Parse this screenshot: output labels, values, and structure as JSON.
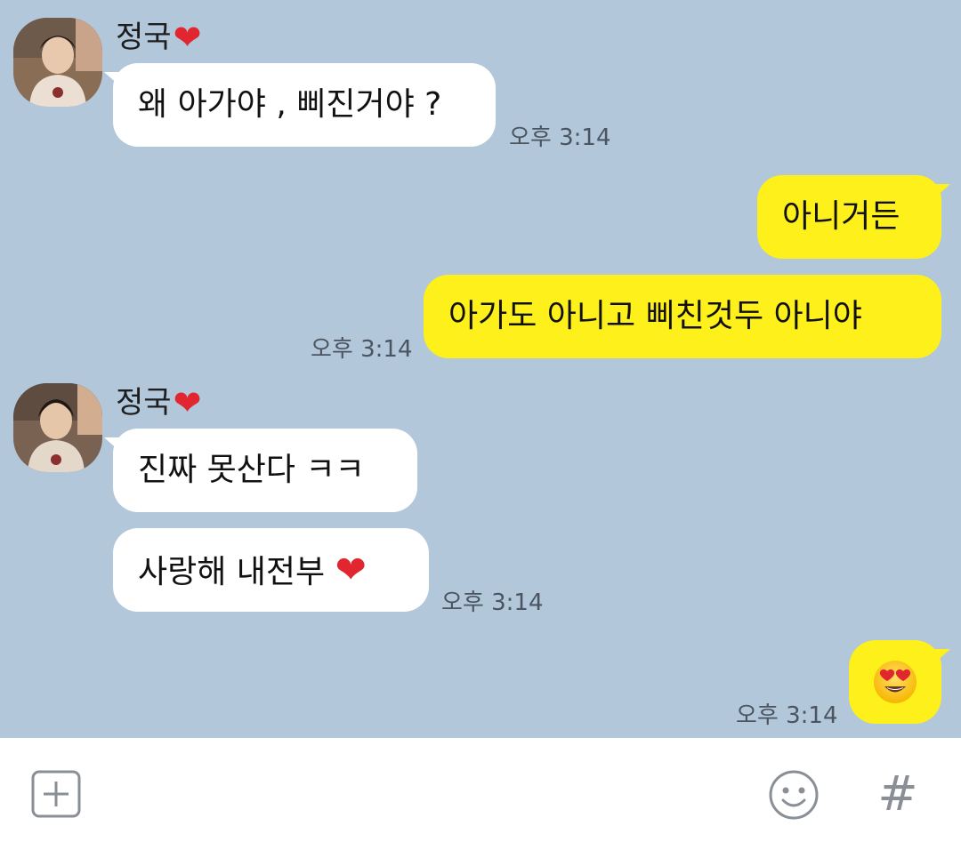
{
  "messages": [
    {
      "sender": "정국",
      "direction": "incoming",
      "texts": [
        "왜 아가야 , 삐진거야 ?"
      ],
      "time": "오후 3:14"
    },
    {
      "direction": "outgoing",
      "texts": [
        "아니거든",
        "아가도 아니고 삐친것두 아니야"
      ],
      "time": "오후 3:14"
    },
    {
      "sender": "정국",
      "direction": "incoming",
      "texts": [
        "진짜 못산다 ㅋㅋ",
        "사랑해 내전부"
      ],
      "heart_after_last": "❤",
      "time": "오후 3:14"
    },
    {
      "direction": "outgoing",
      "emoji": "heart-eyes-emoji",
      "time": "오후 3:14"
    }
  ],
  "sender_heart": "❤",
  "input_bar": {
    "add_icon": "plus-square-icon",
    "emoji_icon": "smiley-icon",
    "hash_label": "#"
  },
  "colors": {
    "chat_background": "#b2c7da",
    "incoming_bubble": "#ffffff",
    "outgoing_bubble": "#fef01b",
    "heart": "#e2262f"
  }
}
